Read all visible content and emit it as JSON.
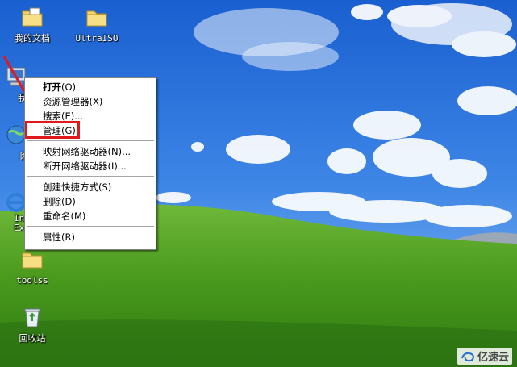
{
  "desktop": {
    "icons": [
      {
        "label": "我的文档",
        "icon": "my-documents-folder-icon"
      },
      {
        "label": "UltraISO",
        "icon": "folder-icon"
      },
      {
        "label": "我的",
        "icon": "my-computer-icon"
      },
      {
        "label": "网_",
        "icon": "network-globe-icon"
      },
      {
        "label": "Int",
        "label2": "Exp",
        "icon": "internet-explorer-icon"
      },
      {
        "label": "toolss",
        "icon": "folder-icon"
      },
      {
        "label": "回收站",
        "icon": "recycle-bin-icon"
      }
    ]
  },
  "context_menu": {
    "items": [
      {
        "label": "打开",
        "shortcut": "(O)"
      },
      {
        "label": "资源管理器",
        "shortcut": "(X)"
      },
      {
        "label": "搜索",
        "shortcut": "(E)..."
      },
      {
        "label": "管理",
        "shortcut": "(G)"
      },
      {
        "label": "映射网络驱动器",
        "shortcut": "(N)..."
      },
      {
        "label": "断开网络驱动器",
        "shortcut": "(I)..."
      },
      {
        "label": "创建快捷方式",
        "shortcut": "(S)"
      },
      {
        "label": "删除",
        "shortcut": "(D)"
      },
      {
        "label": "重命名",
        "shortcut": "(M)"
      },
      {
        "label": "属性",
        "shortcut": "(R)"
      }
    ],
    "highlighted_item": "管理"
  },
  "annotations": {
    "arrow_color": "#e0191c",
    "highlight_color": "#e0191c"
  },
  "watermark": {
    "text": "亿速云"
  }
}
